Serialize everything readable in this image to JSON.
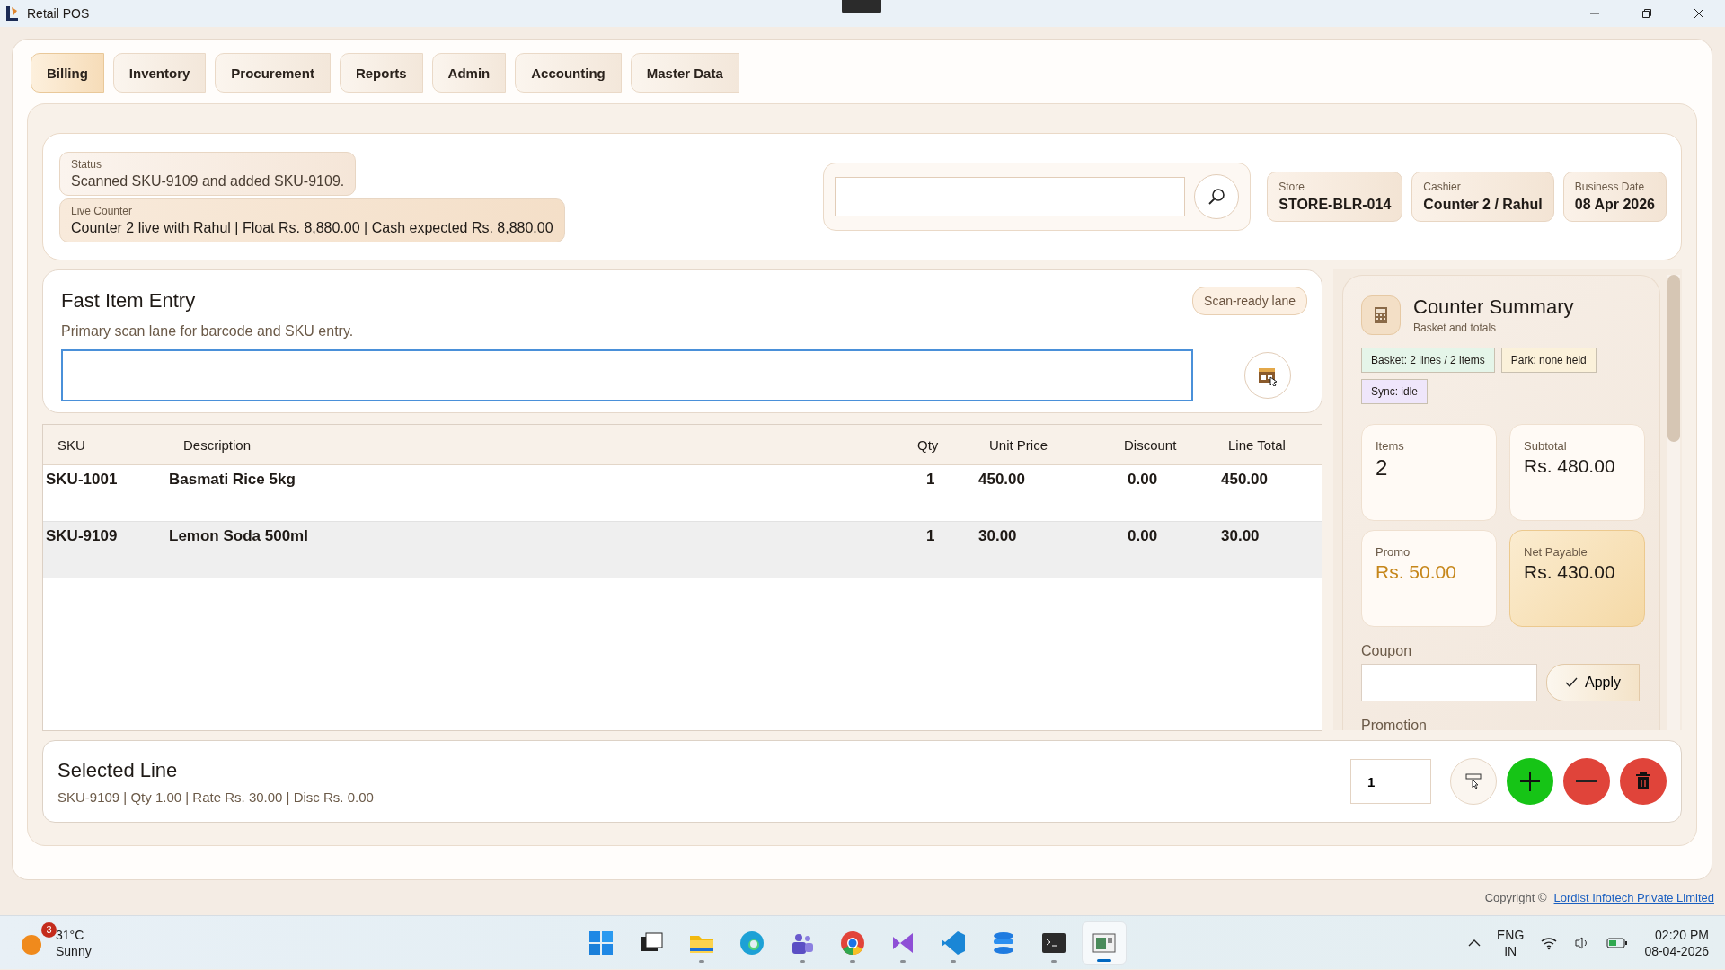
{
  "window": {
    "title": "Retail POS"
  },
  "tabs": [
    {
      "label": "Billing",
      "selected": true
    },
    {
      "label": "Inventory",
      "selected": false
    },
    {
      "label": "Procurement",
      "selected": false
    },
    {
      "label": "Reports",
      "selected": false
    },
    {
      "label": "Admin",
      "selected": false
    },
    {
      "label": "Accounting",
      "selected": false
    },
    {
      "label": "Master Data",
      "selected": false
    }
  ],
  "status": {
    "label": "Status",
    "text": "Scanned SKU-9109 and added SKU-9109."
  },
  "live_counter": {
    "label": "Live Counter",
    "text": "Counter 2 live with Rahul | Float Rs. 8,880.00 | Cash expected Rs. 8,880.00"
  },
  "info_chips": [
    {
      "label": "Store",
      "value": "STORE-BLR-014"
    },
    {
      "label": "Cashier",
      "value": "Counter 2 / Rahul"
    },
    {
      "label": "Business Date",
      "value": "08 Apr 2026"
    }
  ],
  "fast_entry": {
    "title": "Fast Item Entry",
    "subtitle": "Primary scan lane for barcode and SKU entry.",
    "badge": "Scan-ready lane"
  },
  "table": {
    "columns": [
      "SKU",
      "Description",
      "Qty",
      "Unit Price",
      "Discount",
      "Line Total"
    ],
    "rows": [
      {
        "cells": [
          "SKU-1001",
          "Basmati Rice 5kg",
          "1",
          "450.00",
          "0.00",
          "450.00"
        ],
        "selected": false
      },
      {
        "cells": [
          "SKU-9109",
          "Lemon Soda 500ml",
          "1",
          "30.00",
          "0.00",
          "30.00"
        ],
        "selected": true
      }
    ]
  },
  "summary": {
    "title": "Counter Summary",
    "subtitle": "Basket and totals",
    "tags": [
      {
        "text": "Basket: 2 lines / 2 items",
        "color": "#e5f5e9"
      },
      {
        "text": "Park: none held",
        "color": "#fbf1da"
      },
      {
        "text": "Sync: idle",
        "color": "#efe6fb"
      }
    ],
    "metrics": [
      {
        "label": "Items",
        "value": "2",
        "kind": "plain"
      },
      {
        "label": "Subtotal",
        "value": "Rs. 480.00",
        "kind": "plain"
      },
      {
        "label": "Promo",
        "value": "Rs. 50.00",
        "kind": "promo"
      },
      {
        "label": "Net Payable",
        "value": "Rs. 430.00",
        "kind": "highlight"
      }
    ],
    "coupon": {
      "label": "Coupon",
      "button": "Apply"
    },
    "next_section": "Promotion"
  },
  "selected_line": {
    "title": "Selected Line",
    "detail": "SKU-9109 | Qty 1.00 | Rate Rs. 30.00 | Disc Rs. 0.00",
    "qty": "1",
    "actions": [
      {
        "kind": "edit"
      },
      {
        "kind": "add"
      },
      {
        "kind": "remove"
      },
      {
        "kind": "delete"
      }
    ]
  },
  "footer": {
    "copyright": "Copyright ©",
    "link": "Lordist Infotech Private Limited"
  },
  "taskbar": {
    "weather": {
      "temp": "31°C",
      "condition": "Sunny",
      "badge": "3"
    },
    "apps": [
      {
        "kind": "start",
        "running": false,
        "active": false
      },
      {
        "kind": "taskview",
        "running": false,
        "active": false
      },
      {
        "kind": "folder",
        "running": true,
        "active": false
      },
      {
        "kind": "edge",
        "running": false,
        "active": false
      },
      {
        "kind": "teams",
        "running": true,
        "active": false
      },
      {
        "kind": "chrome",
        "running": true,
        "active": false
      },
      {
        "kind": "studio",
        "running": true,
        "active": false
      },
      {
        "kind": "code",
        "running": true,
        "active": false
      },
      {
        "kind": "stack",
        "running": false,
        "active": false
      },
      {
        "kind": "terminal",
        "running": true,
        "active": false
      },
      {
        "kind": "pos",
        "running": true,
        "active": true
      }
    ],
    "language": "ENG",
    "region": "IN",
    "time": "02:20 PM",
    "date": "08-04-2026"
  }
}
